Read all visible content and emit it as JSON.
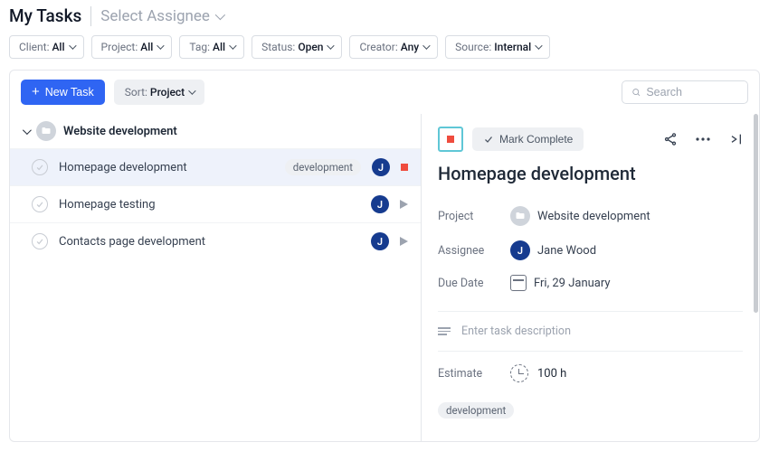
{
  "header": {
    "title": "My Tasks",
    "assignee_select": "Select Assignee"
  },
  "filters": [
    {
      "label": "Client:",
      "value": "All"
    },
    {
      "label": "Project:",
      "value": "All"
    },
    {
      "label": "Tag:",
      "value": "All"
    },
    {
      "label": "Status:",
      "value": "Open"
    },
    {
      "label": "Creator:",
      "value": "Any"
    },
    {
      "label": "Source:",
      "value": "Internal"
    }
  ],
  "toolbar": {
    "new_task": "New Task",
    "sort_label": "Sort:",
    "sort_value": "Project"
  },
  "search": {
    "placeholder": "Search"
  },
  "group": {
    "name": "Website development"
  },
  "tasks": [
    {
      "name": "Homepage development",
      "tag": "development",
      "assignee_initial": "J",
      "running": true,
      "selected": true
    },
    {
      "name": "Homepage testing",
      "tag": null,
      "assignee_initial": "J",
      "running": false,
      "selected": false
    },
    {
      "name": "Contacts page development",
      "tag": null,
      "assignee_initial": "J",
      "running": false,
      "selected": false
    }
  ],
  "detail": {
    "mark_complete": "Mark Complete",
    "title": "Homepage development",
    "labels": {
      "project": "Project",
      "assignee": "Assignee",
      "due_date": "Due Date",
      "estimate": "Estimate"
    },
    "project_name": "Website development",
    "assignee_initial": "J",
    "assignee_name": "Jane Wood",
    "due_date": "Fri, 29 January",
    "description_placeholder": "Enter task description",
    "estimate": "100 h",
    "tags": [
      "development"
    ]
  }
}
